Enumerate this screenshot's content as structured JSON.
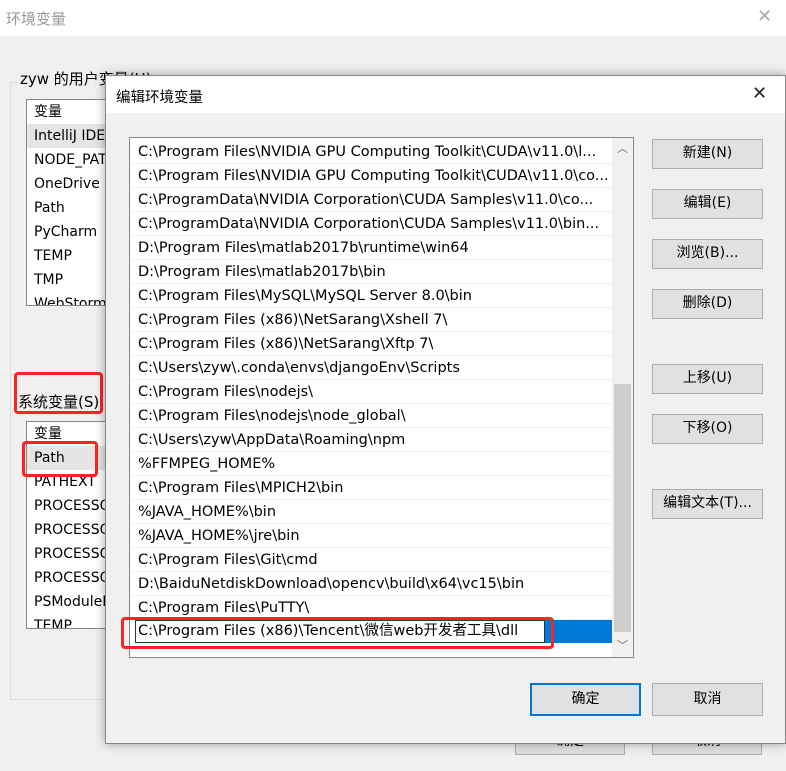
{
  "background": {
    "title": "环境变量",
    "user_group": "zyw 的用户变量(U)",
    "user_header": "变量",
    "user_vars": [
      "IntelliJ IDEA",
      "NODE_PATH",
      "OneDrive",
      "Path",
      "PyCharm",
      "TEMP",
      "TMP",
      "WebStorm"
    ],
    "sys_group": "系统变量(S)",
    "sys_header": "变量",
    "sys_vars": [
      "Path",
      "PATHEXT",
      "PROCESSOR",
      "PROCESSOR",
      "PROCESSOR",
      "PROCESSOR",
      "PSModulePath",
      "TEMP"
    ],
    "ok": "确定",
    "cancel": "取消"
  },
  "dialog": {
    "title": "编辑环境变量",
    "paths": [
      "C:\\Program Files\\NVIDIA GPU Computing Toolkit\\CUDA\\v11.0\\l...",
      "C:\\Program Files\\NVIDIA GPU Computing Toolkit\\CUDA\\v11.0\\co...",
      "C:\\ProgramData\\NVIDIA Corporation\\CUDA Samples\\v11.0\\co...",
      "C:\\ProgramData\\NVIDIA Corporation\\CUDA Samples\\v11.0\\bin...",
      "D:\\Program Files\\matlab2017b\\runtime\\win64",
      "D:\\Program Files\\matlab2017b\\bin",
      "C:\\Program Files\\MySQL\\MySQL Server 8.0\\bin",
      "C:\\Program Files (x86)\\NetSarang\\Xshell 7\\",
      "C:\\Program Files (x86)\\NetSarang\\Xftp 7\\",
      "C:\\Users\\zyw\\.conda\\envs\\djangoEnv\\Scripts",
      "C:\\Program Files\\nodejs\\",
      "C:\\Program Files\\nodejs\\node_global\\",
      "C:\\Users\\zyw\\AppData\\Roaming\\npm",
      "%FFMPEG_HOME%",
      "C:\\Program Files\\MPICH2\\bin",
      "%JAVA_HOME%\\bin",
      "%JAVA_HOME%\\jre\\bin",
      "C:\\Program Files\\Git\\cmd",
      "D:\\BaiduNetdiskDownload\\opencv\\build\\x64\\vc15\\bin",
      "C:\\Program Files\\PuTTY\\"
    ],
    "editing_value": "C:\\Program Files (x86)\\Tencent\\微信web开发者工具\\dll",
    "buttons": {
      "new": "新建(N)",
      "edit": "编辑(E)",
      "browse": "浏览(B)...",
      "delete": "删除(D)",
      "up": "上移(U)",
      "down": "下移(O)",
      "edit_text": "编辑文本(T)..."
    },
    "ok": "确定",
    "cancel": "取消",
    "colors": {
      "selection": "#0078d7",
      "highlight": "#ff2222"
    }
  }
}
